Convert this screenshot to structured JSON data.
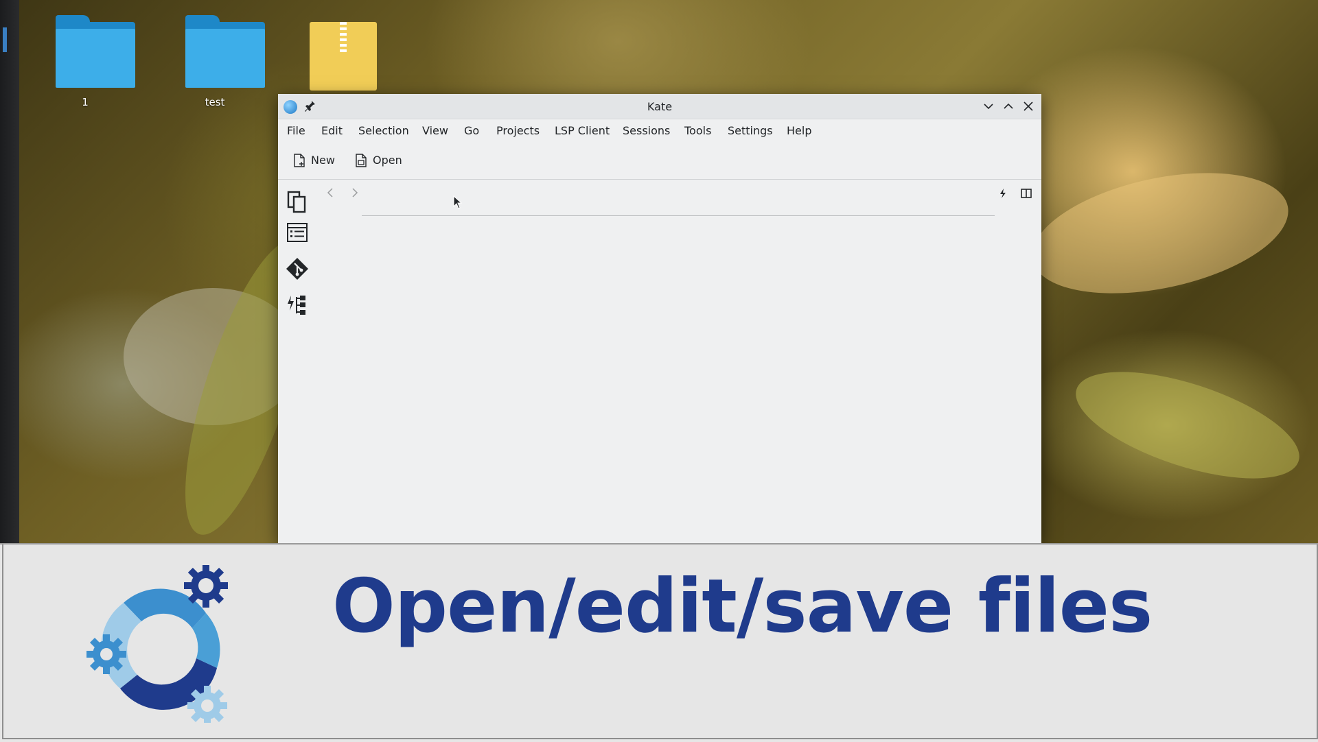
{
  "desktop": {
    "icons": [
      {
        "label": "1",
        "type": "folder"
      },
      {
        "label": "test",
        "type": "folder"
      },
      {
        "label": "",
        "type": "archive"
      }
    ]
  },
  "window": {
    "title": "Kate",
    "app_icon": "kate-icon",
    "menu": [
      "File",
      "Edit",
      "Selection",
      "View",
      "Go",
      "Projects",
      "LSP Client",
      "Sessions",
      "Tools",
      "Settings",
      "Help"
    ],
    "toolbar": {
      "new_label": "New",
      "open_label": "Open"
    },
    "sidebar_icons": [
      "documents-icon",
      "outline-list-icon",
      "git-icon",
      "symbols-tree-icon"
    ]
  },
  "banner": {
    "title": "Open/edit/save files"
  },
  "colors": {
    "banner_text": "#1f3b8c",
    "folder": "#3daee9",
    "archive": "#f1cd57",
    "window_bg": "#eff0f1"
  }
}
